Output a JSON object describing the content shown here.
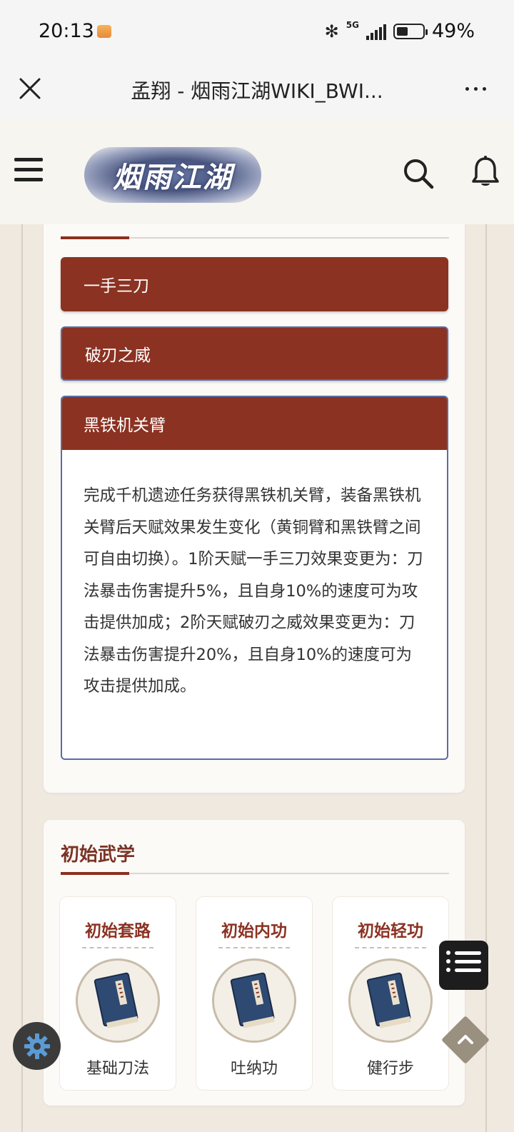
{
  "status_bar": {
    "time": "20:13",
    "network": "5G",
    "battery": "49%"
  },
  "browser": {
    "page_title": "孟翔 - 烟雨江湖WIKI_BWI...",
    "close_icon": "close-icon",
    "more_icon": "more-icon"
  },
  "header": {
    "logo_text": "烟雨江湖",
    "menu_icon": "hamburger-icon",
    "search_icon": "search-icon",
    "bell_icon": "bell-icon"
  },
  "talents": {
    "items": [
      {
        "label": "一手三刀"
      },
      {
        "label": "破刃之威"
      },
      {
        "label": "黑铁机关臂"
      }
    ],
    "open_content": "完成千机遗迹任务获得黑铁机关臂，装备黑铁机关臂后天赋效果发生变化（黄铜臂和黑铁臂之间可自由切换）。1阶天赋一手三刀效果变更为：刀法暴击伤害提升5%，且自身10%的速度可为攻击提供加成；2阶天赋破刃之威效果变更为：刀法暴击伤害提升20%，且自身10%的速度可为攻击提供加成。"
  },
  "initial_skills": {
    "title": "初始武学",
    "items": [
      {
        "category": "初始套路",
        "name": "基础刀法"
      },
      {
        "category": "初始内功",
        "name": "吐纳功"
      },
      {
        "category": "初始轻功",
        "name": "健行步"
      }
    ]
  },
  "colors": {
    "accent": "#8b3222",
    "page_bg": "#efe9e0",
    "card_bg": "#fbfaf7"
  }
}
